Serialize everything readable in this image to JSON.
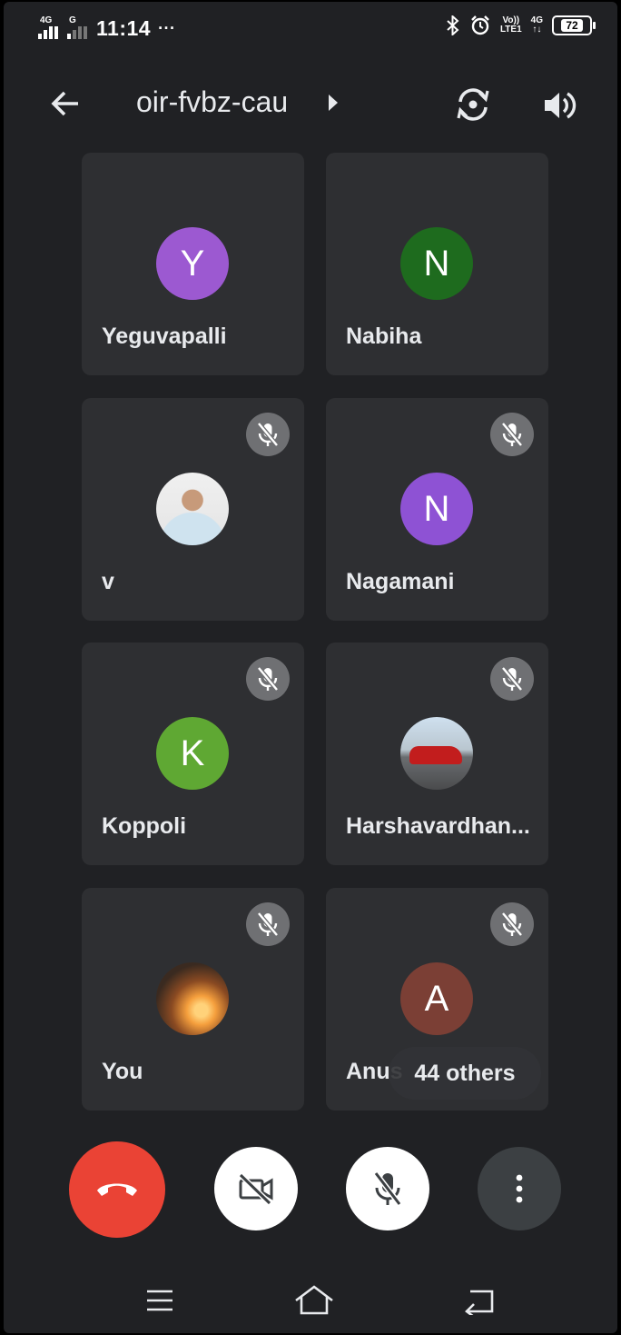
{
  "status_bar": {
    "network1": "4G",
    "network2": "G",
    "time": "11:14",
    "more": "···",
    "volte": "Vo))",
    "lte": "LTE1",
    "network3": "4G",
    "battery": "72"
  },
  "header": {
    "meeting_code": "oir-fvbz-cau"
  },
  "tiles": [
    {
      "name": "Yeguvapalli",
      "initial": "Y",
      "color": "#9c59d1",
      "muted": false
    },
    {
      "name": "Nabiha",
      "initial": "N",
      "color": "#1e6b1e",
      "muted": false
    },
    {
      "name": "v",
      "initial": "",
      "photo": "person",
      "muted": true
    },
    {
      "name": "Nagamani",
      "initial": "N",
      "color": "#8e52d4",
      "muted": true
    },
    {
      "name": "Koppoli",
      "initial": "K",
      "color": "#5fa833",
      "muted": true
    },
    {
      "name": "Harshavardhan...",
      "initial": "",
      "photo": "car",
      "muted": true
    },
    {
      "name": "You",
      "initial": "",
      "photo": "sunset",
      "muted": true
    },
    {
      "name": "Anus",
      "initial": "A",
      "color": "#7b3f35",
      "muted": true
    }
  ],
  "others_pill": "44 others",
  "colors": {
    "background": "#202124",
    "tile": "#2e2f32",
    "end_call": "#ea4335"
  },
  "icons": {
    "back": "arrow-left-icon",
    "dropdown": "caret-right-icon",
    "switch_camera": "camera-flip-icon",
    "audio": "speaker-icon",
    "muted": "mic-off-icon",
    "end_call": "phone-hangup-icon",
    "camera": "video-off-icon",
    "microphone": "mic-off-icon",
    "more": "more-vert-icon"
  }
}
